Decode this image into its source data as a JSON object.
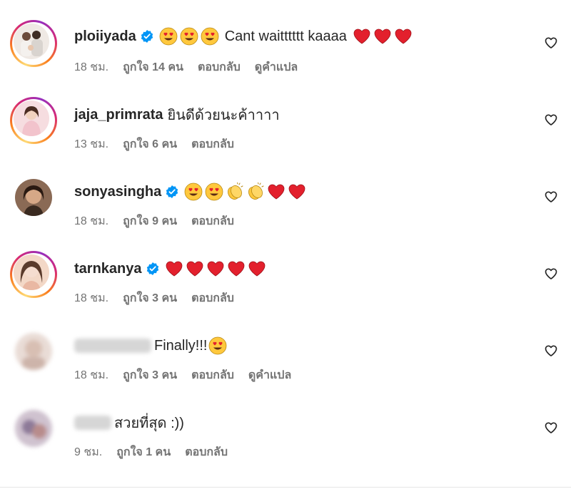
{
  "comments": [
    {
      "username": "ploiiyada",
      "verified": true,
      "emojis_before": [
        "heart-eyes",
        "heart-eyes",
        "heart-eyes"
      ],
      "text": "Cant waitttttt kaaaa",
      "emojis_after": [
        "red-heart",
        "red-heart",
        "red-heart"
      ],
      "time": "18 ชม.",
      "likes": "ถูกใจ 14 คน",
      "reply": "ตอบกลับ",
      "translate": "ดูคำแปล"
    },
    {
      "username": "jaja_primrata",
      "verified": false,
      "text": "ยินดีด้วยนะค้าาาา",
      "time": "13 ชม.",
      "likes": "ถูกใจ 6 คน",
      "reply": "ตอบกลับ"
    },
    {
      "username": "sonyasingha",
      "verified": true,
      "emojis_after": [
        "heart-eyes",
        "heart-eyes",
        "clapping-hands",
        "clapping-hands",
        "red-heart",
        "red-heart"
      ],
      "time": "18 ชม.",
      "likes": "ถูกใจ 9 คน",
      "reply": "ตอบกลับ"
    },
    {
      "username": "tarnkanya",
      "verified": true,
      "emojis_after": [
        "red-heart",
        "red-heart",
        "red-heart",
        "red-heart",
        "red-heart"
      ],
      "time": "18 ชม.",
      "likes": "ถูกใจ 3 คน",
      "reply": "ตอบกลับ"
    },
    {
      "username_blurred": true,
      "text": "Finally!!!",
      "emojis_after": [
        "heart-eyes"
      ],
      "time": "18 ชม.",
      "likes": "ถูกใจ 3 คน",
      "reply": "ตอบกลับ",
      "translate": "ดูคำแปล"
    },
    {
      "username_blurred": true,
      "text": "สวยที่สุด :))",
      "time": "9 ชม.",
      "likes": "ถูกใจ 1 คน",
      "reply": "ตอบกลับ"
    }
  ],
  "icons": {
    "like": "heart-outline-icon",
    "verified": "verified-badge-icon"
  },
  "colors": {
    "text": "#262626",
    "meta": "#737373",
    "verified": "#0095f6",
    "heart": "#e3202d",
    "emoji_face": "#ffc83d"
  }
}
